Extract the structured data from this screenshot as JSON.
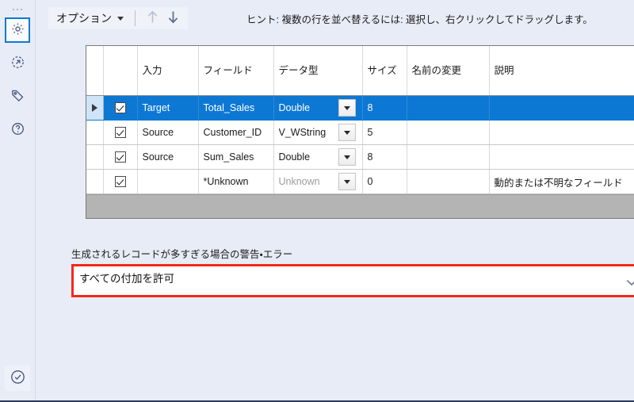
{
  "sidebar": {
    "items": [
      {
        "name": "configuration",
        "icon": "gear-icon",
        "selected": true
      },
      {
        "name": "run",
        "icon": "refresh-arrow-icon",
        "selected": false
      },
      {
        "name": "annotation",
        "icon": "tag-icon",
        "selected": false
      },
      {
        "name": "help",
        "icon": "question-circle-icon",
        "selected": false
      }
    ],
    "bottom_item": {
      "name": "status",
      "icon": "check-circle-icon"
    }
  },
  "toolbar": {
    "options_label": "オプション",
    "caret_icon": "chevron-down-icon",
    "move_up_icon": "arrow-up-icon",
    "move_down_icon": "arrow-down-icon",
    "hint_text": "ヒント: 複数の行を並べ替えるには: 選択し、右クリックしてドラッグします。"
  },
  "grid": {
    "headers": {
      "selector": "",
      "checkbox": "",
      "input": "入力",
      "field": "フィールド",
      "datatype": "データ型",
      "size": "サイズ",
      "rename": "名前の変更",
      "description": "説明"
    },
    "rows": [
      {
        "selected": true,
        "checked": true,
        "input": "Target",
        "field": "Total_Sales",
        "datatype": "Double",
        "datatype_dim": false,
        "size": "8",
        "size_dim": false,
        "rename": "",
        "description": ""
      },
      {
        "selected": false,
        "checked": true,
        "input": "Source",
        "field": "Customer_ID",
        "datatype": "V_WString",
        "datatype_dim": false,
        "size": "5",
        "size_dim": false,
        "rename": "",
        "description": ""
      },
      {
        "selected": false,
        "checked": true,
        "input": "Source",
        "field": "Sum_Sales",
        "datatype": "Double",
        "datatype_dim": false,
        "size": "8",
        "size_dim": true,
        "rename": "",
        "description": ""
      },
      {
        "selected": false,
        "checked": true,
        "input": "",
        "field": "*Unknown",
        "datatype": "Unknown",
        "datatype_dim": true,
        "size": "0",
        "size_dim": true,
        "rename": "",
        "description": "動的または不明なフィールド"
      }
    ]
  },
  "warning_section": {
    "label": "生成されるレコードが多すぎる場合の警告・エラー",
    "selected_value": "すべての付加を許可",
    "chevron_icon": "chevron-down-icon",
    "highlight_color": "#f4291c"
  },
  "colors": {
    "background": "#e8ecf7",
    "selection_blue": "#0c78d4",
    "accent_selected_border": "#0f7ad1",
    "grid_footer": "#b4b4b4"
  }
}
